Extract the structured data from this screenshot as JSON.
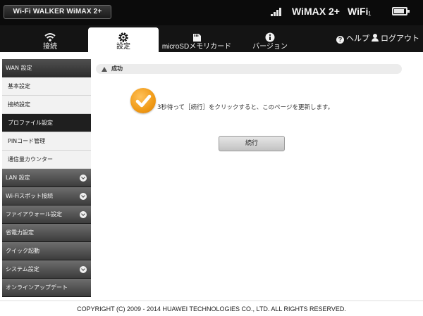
{
  "device": {
    "title": "Wi-Fi WALKER WiMAX 2+"
  },
  "status": {
    "network": "WiMAX 2+",
    "wifi_label": "WiFi",
    "wifi_sub": "1",
    "signal_level": 4,
    "battery_level": 0.85,
    "icons": [
      "signal-icon",
      "battery-icon"
    ]
  },
  "nav": {
    "tabs": [
      {
        "label": "接続",
        "icon": "wifi-icon",
        "active": false
      },
      {
        "label": "設定",
        "icon": "gear-icon",
        "active": true
      },
      {
        "label": "microSDメモリカード",
        "icon": "sd-card-icon",
        "active": false
      },
      {
        "label": "バージョン",
        "icon": "info-icon",
        "active": false
      }
    ],
    "help": "ヘルプ",
    "logout": "ログアウト"
  },
  "sidebar": {
    "header": "WAN 設定",
    "sub_items": [
      {
        "label": "基本設定",
        "active": false
      },
      {
        "label": "接続設定",
        "active": false
      },
      {
        "label": "プロファイル設定",
        "active": true
      },
      {
        "label": "PINコード管理",
        "active": false
      },
      {
        "label": "通信量カウンター",
        "active": false
      }
    ],
    "groups": [
      {
        "label": "LAN 設定",
        "expandable": true
      },
      {
        "label": "Wi-Fiスポット接続",
        "expandable": true
      },
      {
        "label": "ファイアウォール設定",
        "expandable": true
      },
      {
        "label": "省電力設定",
        "expandable": false
      },
      {
        "label": "クイック起動",
        "expandable": false
      },
      {
        "label": "システム設定",
        "expandable": true
      },
      {
        "label": "オンラインアップデート",
        "expandable": false
      }
    ]
  },
  "main": {
    "notice": "成功",
    "message": "3秒待って［続行］をクリックすると、このページを更新します。",
    "continue_label": "続行"
  },
  "footer": {
    "copyright": "COPYRIGHT (C) 2009 - 2014 HUAWEI TECHNOLOGIES CO., LTD. ALL RIGHTS RESERVED."
  },
  "colors": {
    "accent_orange": "#f09a16",
    "topbar": "#0b0b0b",
    "nav": "#141414"
  }
}
